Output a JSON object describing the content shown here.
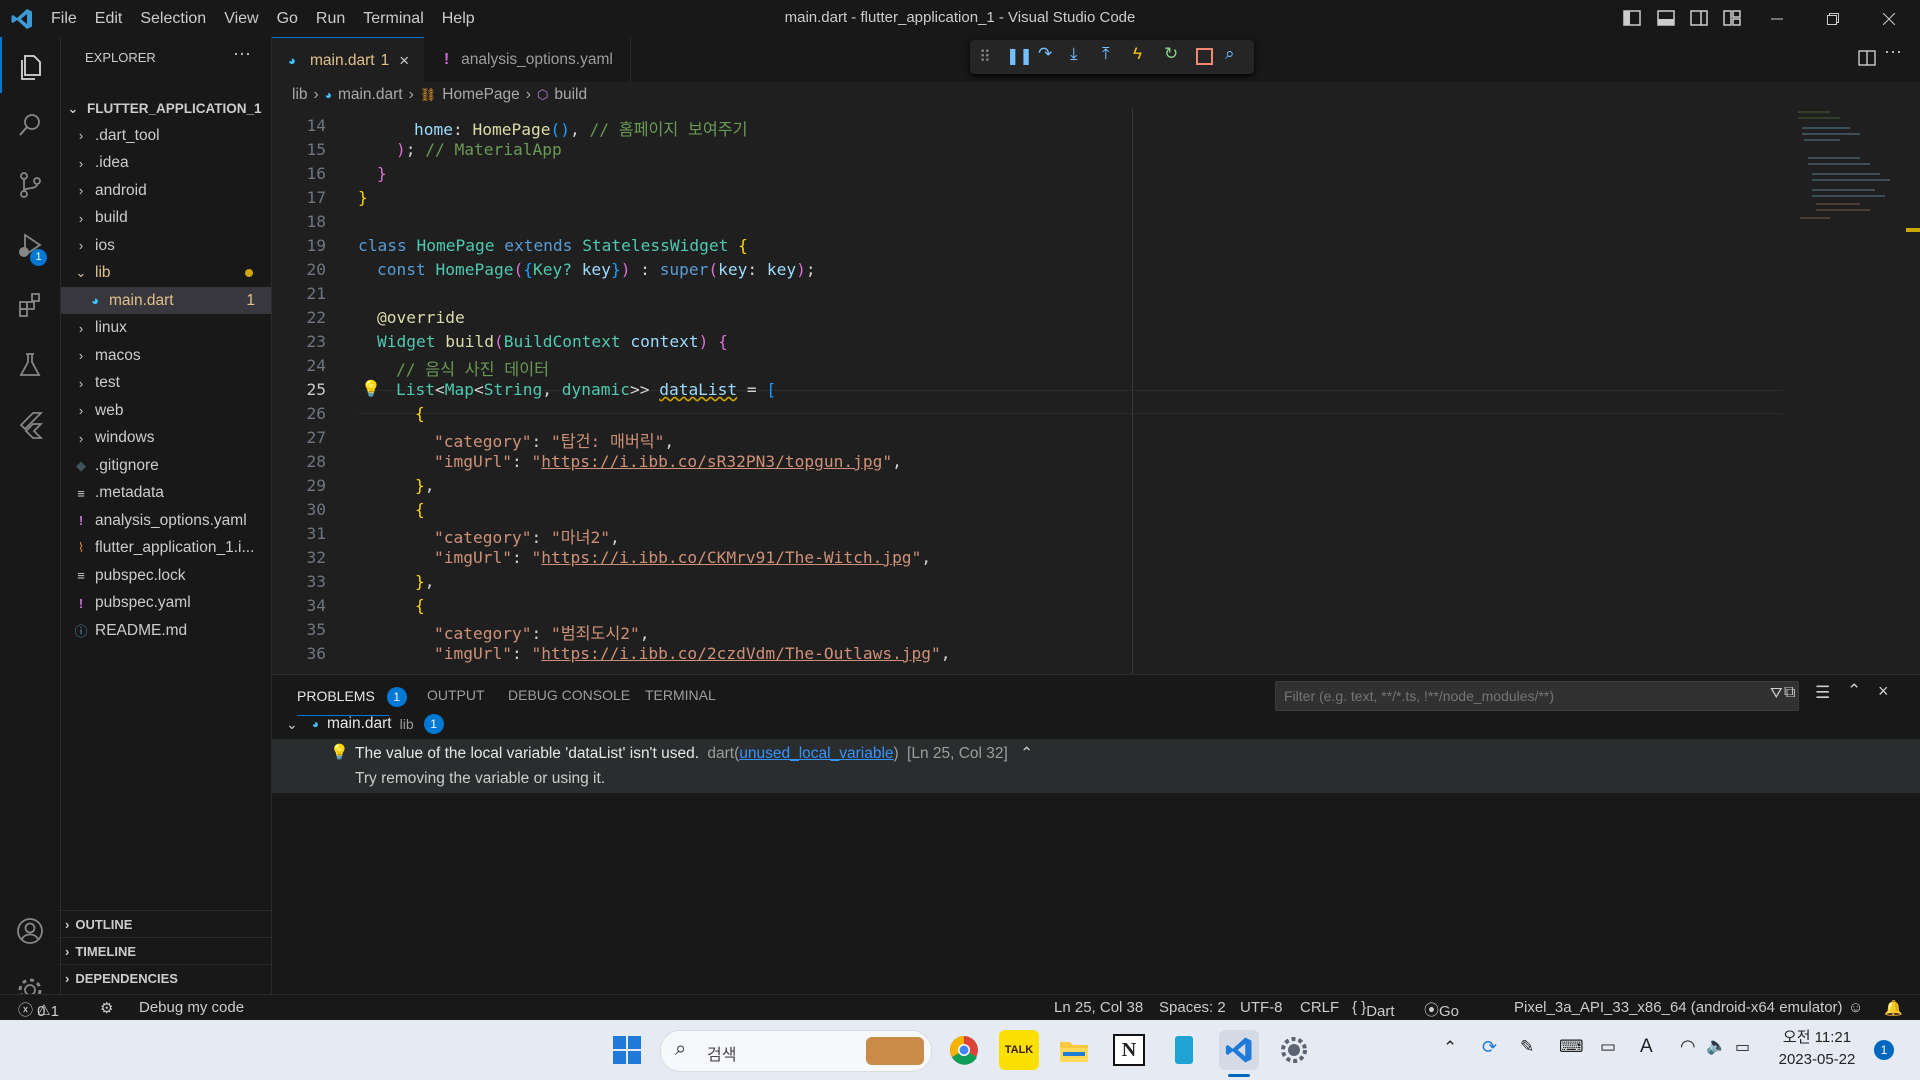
{
  "window": {
    "title": "main.dart - flutter_application_1 - Visual Studio Code",
    "menu": [
      "File",
      "Edit",
      "Selection",
      "View",
      "Go",
      "Run",
      "Terminal",
      "Help"
    ]
  },
  "explorer": {
    "header": "EXPLORER",
    "root": "FLUTTER_APPLICATION_1",
    "items": [
      {
        "label": ".dart_tool",
        "kind": "folder"
      },
      {
        "label": ".idea",
        "kind": "folder"
      },
      {
        "label": "android",
        "kind": "folder"
      },
      {
        "label": "build",
        "kind": "folder"
      },
      {
        "label": "ios",
        "kind": "folder"
      },
      {
        "label": "lib",
        "kind": "folder-open"
      },
      {
        "label": "main.dart",
        "kind": "file",
        "badge": "1"
      },
      {
        "label": "linux",
        "kind": "folder"
      },
      {
        "label": "macos",
        "kind": "folder"
      },
      {
        "label": "test",
        "kind": "folder"
      },
      {
        "label": "web",
        "kind": "folder"
      },
      {
        "label": "windows",
        "kind": "folder"
      },
      {
        "label": ".gitignore",
        "kind": "file"
      },
      {
        "label": ".metadata",
        "kind": "file"
      },
      {
        "label": "analysis_options.yaml",
        "kind": "file"
      },
      {
        "label": "flutter_application_1.i...",
        "kind": "file"
      },
      {
        "label": "pubspec.lock",
        "kind": "file"
      },
      {
        "label": "pubspec.yaml",
        "kind": "file"
      },
      {
        "label": "README.md",
        "kind": "file"
      }
    ],
    "sections": [
      "OUTLINE",
      "TIMELINE",
      "DEPENDENCIES"
    ]
  },
  "tabs": [
    {
      "label": "main.dart",
      "badge": "1"
    },
    {
      "label": "analysis_options.yaml"
    }
  ],
  "breadcrumb": [
    "lib",
    "main.dart",
    "HomePage",
    "build"
  ],
  "code": {
    "line_numbers": [
      "14",
      "15",
      "16",
      "17",
      "18",
      "19",
      "20",
      "21",
      "22",
      "23",
      "24",
      "25",
      "26",
      "27",
      "28",
      "29",
      "30",
      "31",
      "32",
      "33",
      "34",
      "35",
      "36"
    ],
    "line14_home": "home",
    "line14_class": "HomePage",
    "line14_comment": "// 홈페이지 보여주기",
    "line15_comment": "// MaterialApp",
    "line19_kw1": "class",
    "line19_class": "HomePage",
    "line19_kw2": "extends",
    "line19_base": "StatelessWidget",
    "line20_const": "const",
    "line20_ctor": "HomePage",
    "line20_key_type": "Key?",
    "line20_key": "key",
    "line20_super": "super",
    "line22_annotation": "@override",
    "line23_type": "Widget",
    "line23_fn": "build",
    "line23_param_type": "BuildContext",
    "line23_param": "context",
    "line24_comment": "// 음식 사진 데이터",
    "line25_list": "List",
    "line25_map": "Map",
    "line25_string": "String",
    "line25_dynamic": "dynamic",
    "line25_var": "dataList",
    "key_category": "\"category\"",
    "key_imgurl": "\"imgUrl\"",
    "cat1": "\"탑건: 매버릭\"",
    "url1": "https://i.ibb.co/sR32PN3/topgun.jpg",
    "cat2": "\"마녀2\"",
    "url2": "https://i.ibb.co/CKMrv91/The-Witch.jpg",
    "cat3": "\"범죄도시2\"",
    "url3": "https://i.ibb.co/2czdVdm/The-Outlaws.jpg"
  },
  "panel": {
    "tabs": [
      "PROBLEMS",
      "OUTPUT",
      "DEBUG CONSOLE",
      "TERMINAL"
    ],
    "problems_count": "1",
    "filter_placeholder": "Filter (e.g. text, **/*.ts, !**/node_modules/**)",
    "group_file": "main.dart",
    "group_folder": "lib",
    "group_count": "1",
    "problem_message": "The value of the local variable 'dataList' isn't used.",
    "problem_source": "dart",
    "problem_code": "unused_local_variable",
    "problem_location": "[Ln 25, Col 32]",
    "problem_hint": "Try removing the variable or using it."
  },
  "status": {
    "errors": "0",
    "warnings": "1",
    "debug": "Debug my code",
    "position": "Ln 25, Col 38",
    "spaces": "Spaces: 2",
    "encoding": "UTF-8",
    "eol": "CRLF",
    "language": "Dart",
    "golive": "Go Live",
    "device": "Pixel_3a_API_33_x86_64 (android-x64 emulator)"
  },
  "taskbar": {
    "search_placeholder": "검색",
    "time": "오전 11:21",
    "date": "2023-05-22",
    "notifications": "1"
  },
  "colors": {
    "accent": "#0078d4",
    "badge": "#0078d4",
    "warning_dot": "#cca700"
  }
}
